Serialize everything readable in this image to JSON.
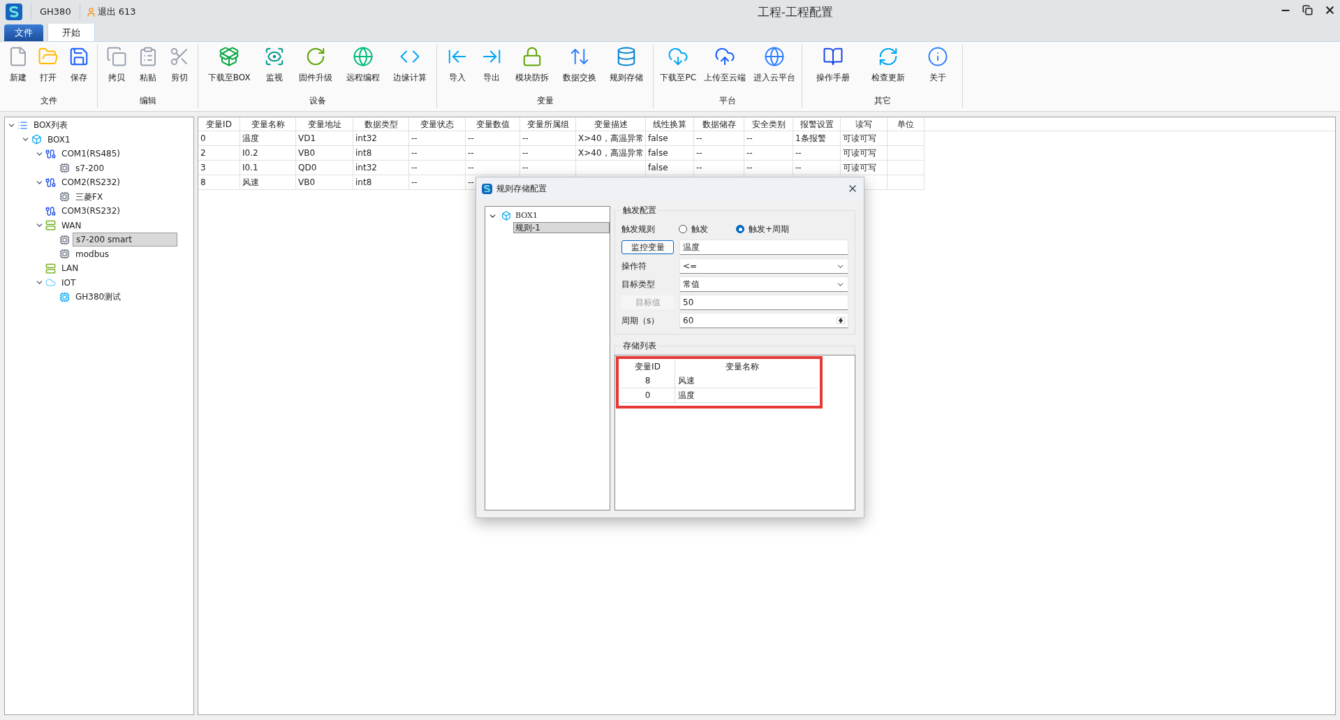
{
  "window": {
    "device": "GH380",
    "user": "退出 613",
    "title": "工程-工程配置"
  },
  "tabs": [
    {
      "label": "文件",
      "selected": false
    },
    {
      "label": "开始",
      "selected": true
    }
  ],
  "ribbon": [
    {
      "group": "文件",
      "buttons": [
        "新建",
        "打开",
        "保存"
      ]
    },
    {
      "group": "编辑",
      "buttons": [
        "拷贝",
        "粘贴",
        "剪切"
      ]
    },
    {
      "group": "设备",
      "buttons": [
        "下载至BOX",
        "监视",
        "固件升级",
        "远程编程",
        "边缘计算"
      ]
    },
    {
      "group": "变量",
      "buttons": [
        "导入",
        "导出",
        "模块防拆",
        "数据交换",
        "规则存储"
      ]
    },
    {
      "group": "平台",
      "buttons": [
        "下载至PC",
        "上传至云端",
        "进入云平台"
      ]
    },
    {
      "group": "其它",
      "buttons": [
        "操作手册",
        "检查更新",
        "关于"
      ]
    }
  ],
  "tree": [
    {
      "label": "BOX列表",
      "kind": "list",
      "expanded": true,
      "selected": false,
      "children": [
        {
          "label": "BOX1",
          "kind": "box",
          "expanded": true,
          "selected": false,
          "children": [
            {
              "label": "COM1(RS485)",
              "kind": "port",
              "expanded": true,
              "selected": false,
              "children": [
                {
                  "label": "s7-200",
                  "kind": "device",
                  "selected": false
                }
              ]
            },
            {
              "label": "COM2(RS232)",
              "kind": "port",
              "expanded": true,
              "selected": false,
              "children": [
                {
                  "label": "三菱FX",
                  "kind": "device",
                  "selected": false
                }
              ]
            },
            {
              "label": "COM3(RS232)",
              "kind": "port",
              "selected": false
            },
            {
              "label": "WAN",
              "kind": "network",
              "expanded": true,
              "selected": false,
              "children": [
                {
                  "label": "s7-200 smart",
                  "kind": "device",
                  "selected": true
                },
                {
                  "label": "modbus",
                  "kind": "device",
                  "selected": false
                }
              ]
            },
            {
              "label": "LAN",
              "kind": "network",
              "selected": false
            },
            {
              "label": "IOT",
              "kind": "cloud",
              "expanded": true,
              "selected": false,
              "children": [
                {
                  "label": "GH380测试",
                  "kind": "cloud-device",
                  "selected": false
                }
              ]
            }
          ]
        }
      ]
    }
  ],
  "table": {
    "columns": [
      "变量ID",
      "变量名称",
      "变量地址",
      "数据类型",
      "变量状态",
      "变量数值",
      "变量所属组",
      "变量描述",
      "线性换算",
      "数据储存",
      "安全类别",
      "报警设置",
      "读写",
      "单位"
    ],
    "rows": [
      [
        "0",
        "温度",
        "VD1",
        "int32",
        "--",
        "--",
        "--",
        "X>40，高温异常",
        "false",
        "--",
        "--",
        "1条报警",
        "可读可写"
      ],
      [
        "2",
        "I0.2",
        "VB0",
        "int8",
        "--",
        "--",
        "--",
        "X>40，高温异常",
        "false",
        "--",
        "--",
        "--",
        "可读可写"
      ],
      [
        "3",
        "I0.1",
        "QD0",
        "int32",
        "--",
        "--",
        "--",
        null,
        "false",
        "--",
        "--",
        "--",
        "可读可写"
      ],
      [
        "8",
        "风速",
        "VB0",
        "int8",
        "--",
        "--"
      ]
    ]
  },
  "dialog": {
    "title": "规则存储配置",
    "tree": {
      "label": "BOX1",
      "expanded": true,
      "children": [
        {
          "label": "规则-1",
          "selected": true
        }
      ]
    },
    "trigger": {
      "title": "触发配置",
      "rule_label": "触发规则",
      "radios": [
        {
          "label": "触发",
          "selected": false
        },
        {
          "label": "触发+周期",
          "selected": true
        }
      ],
      "monitor_button": "监控变量",
      "monitor_value": "温度",
      "operator": {
        "label": "操作符",
        "value": "<="
      },
      "target_type": {
        "label": "目标类型",
        "value": "常值"
      },
      "target_value": {
        "label": "目标值",
        "value": "50",
        "disabled": true
      },
      "period": {
        "label": "周期（s）",
        "value": "60"
      }
    },
    "storage": {
      "title": "存储列表",
      "columns": [
        "变量ID",
        "变量名称"
      ],
      "rows": [
        [
          "8",
          "风速"
        ],
        [
          "0",
          "温度"
        ]
      ]
    }
  }
}
